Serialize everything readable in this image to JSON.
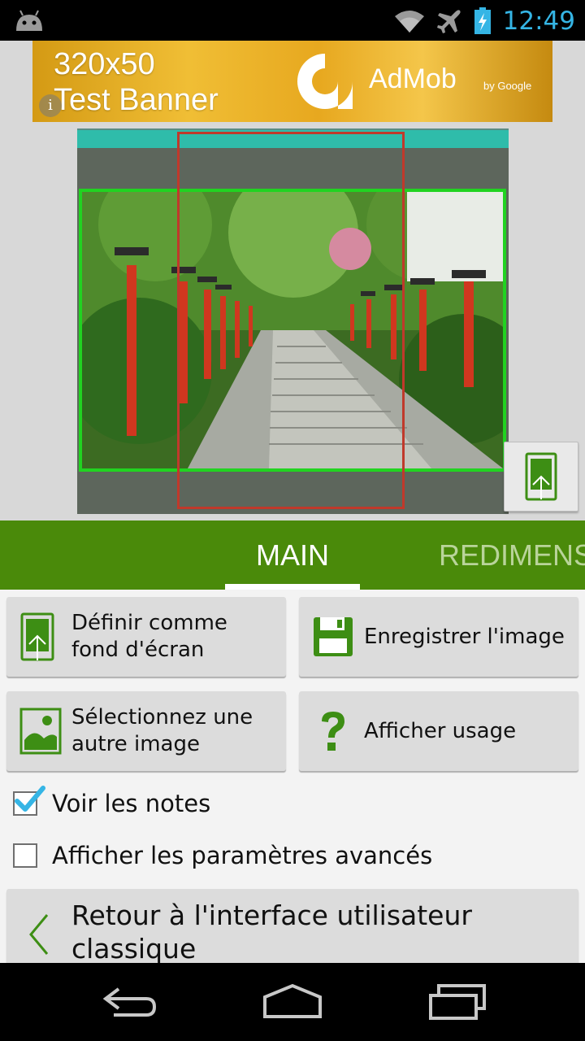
{
  "status_bar": {
    "time": "12:49"
  },
  "ad_banner": {
    "line1": "320x50",
    "line2": "Test Banner",
    "brand": "AdMob",
    "byline": "by Google",
    "info_icon": "i"
  },
  "tabs": [
    {
      "label": "MAIN",
      "selected": true
    },
    {
      "label": "REDIMENS",
      "selected": false
    }
  ],
  "buttons": {
    "set_wallpaper": "Définir comme fond d'écran",
    "save_image": "Enregistrer l'image",
    "select_image": "Sélectionnez une autre image",
    "show_usage": "Afficher usage"
  },
  "checkboxes": [
    {
      "label": "Voir les notes",
      "checked": true
    },
    {
      "label": "Afficher les paramètres avancés",
      "checked": false
    }
  ],
  "back_button": {
    "label": "Retour à l'interface utilisateur classique"
  },
  "icons": {
    "status": [
      "android-icon",
      "wifi-icon",
      "airplane-icon",
      "battery-charging-icon"
    ],
    "nav": [
      "back-icon",
      "home-icon",
      "recents-icon"
    ]
  },
  "colors": {
    "accent_green": "#4a8a0a",
    "icon_green": "#3d8e14",
    "clock_blue": "#35b5e5",
    "frame_green": "#21d321",
    "crop_red": "#c0392b"
  }
}
